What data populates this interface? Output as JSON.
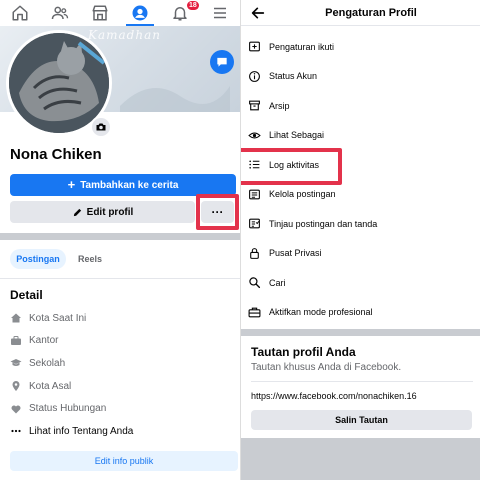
{
  "colors": {
    "accent": "#1877f2",
    "highlight": "#e3324b",
    "badge": "#e41e3f",
    "light_accent": "#e7f3ff"
  },
  "left": {
    "nav": [
      {
        "icon": "home-icon"
      },
      {
        "icon": "friends-icon"
      },
      {
        "icon": "marketplace-icon"
      },
      {
        "icon": "profile-icon",
        "active": true
      },
      {
        "icon": "bell-icon",
        "badge": "18"
      },
      {
        "icon": "menu-icon"
      }
    ],
    "cover_text": "Kamadhan",
    "profile_name": "Nona Chiken",
    "add_story_label": "Tambahkan ke cerita",
    "edit_profile_label": "Edit profil",
    "more_label": "···",
    "tabs": [
      {
        "label": "Postingan"
      },
      {
        "label": "Reels"
      }
    ],
    "detail_title": "Detail",
    "details": [
      {
        "icon": "home-icon",
        "label": "Kota Saat Ini"
      },
      {
        "icon": "briefcase-icon",
        "label": "Kantor"
      },
      {
        "icon": "graduation-cap-icon",
        "label": "Sekolah"
      },
      {
        "icon": "location-pin-icon",
        "label": "Kota Asal"
      },
      {
        "icon": "heart-icon",
        "label": "Status Hubungan"
      },
      {
        "icon": "more-dots-icon",
        "label": "Lihat info Tentang Anda"
      }
    ],
    "edit_public_label": "Edit info publik"
  },
  "right": {
    "title": "Pengaturan Profil",
    "menu": [
      {
        "icon": "settings-follow-icon",
        "label": "Pengaturan ikuti"
      },
      {
        "icon": "info-icon",
        "label": "Status Akun"
      },
      {
        "icon": "archive-icon",
        "label": "Arsip"
      },
      {
        "icon": "eye-icon",
        "label": "Lihat Sebagai"
      },
      {
        "icon": "list-icon",
        "label": "Log aktivitas"
      },
      {
        "icon": "manage-posts-icon",
        "label": "Kelola postingan"
      },
      {
        "icon": "review-tags-icon",
        "label": "Tinjau postingan dan tanda"
      },
      {
        "icon": "lock-icon",
        "label": "Pusat Privasi"
      },
      {
        "icon": "search-icon",
        "label": "Cari"
      },
      {
        "icon": "briefcase-icon",
        "label": "Aktifkan mode profesional"
      }
    ],
    "link_title": "Tautan profil Anda",
    "link_subtitle": "Tautan khusus Anda di Facebook.",
    "link_url": "https://www.facebook.com/nonachiken.16",
    "copy_label": "Salin Tautan"
  }
}
